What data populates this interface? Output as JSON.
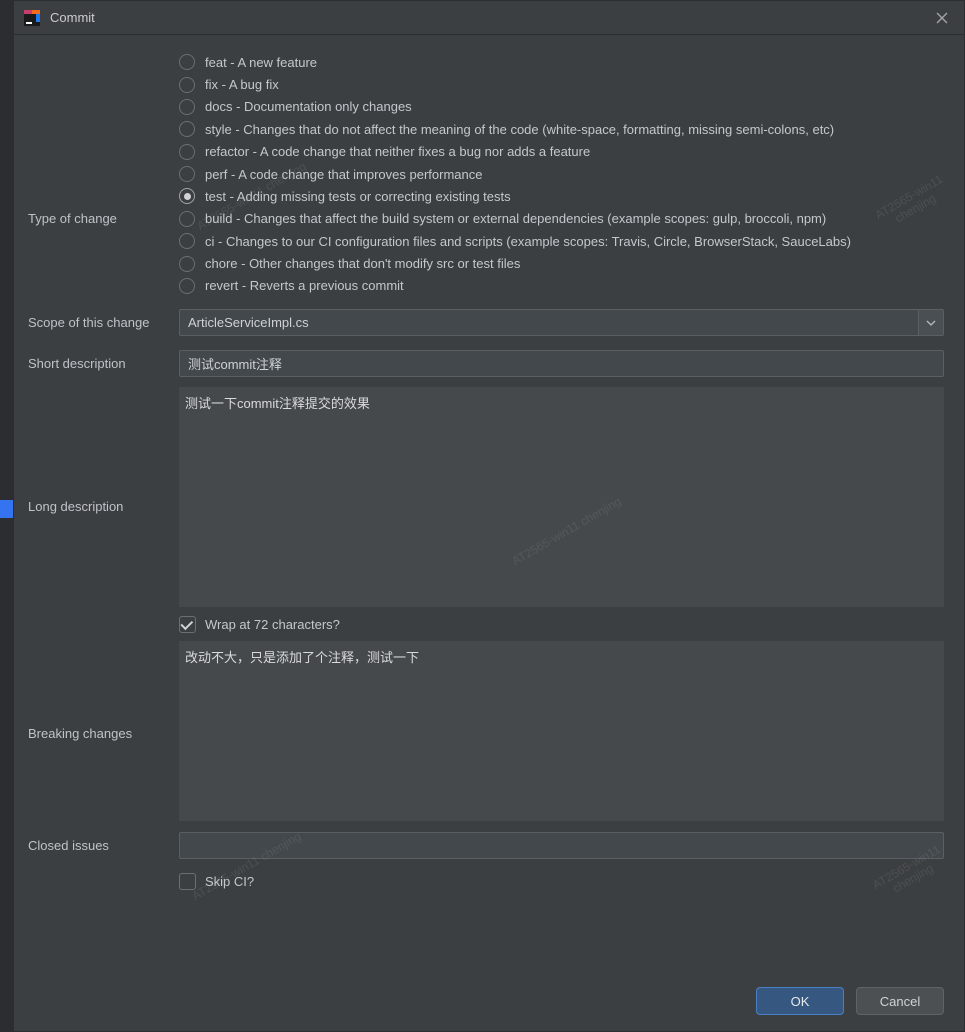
{
  "window": {
    "title": "Commit"
  },
  "labels": {
    "type_of_change": "Type of change",
    "scope": "Scope of this change",
    "short_desc": "Short description",
    "long_desc": "Long description",
    "breaking": "Breaking changes",
    "closed_issues": "Closed issues"
  },
  "change_types": [
    {
      "key": "feat",
      "label": "feat - A new feature",
      "selected": false
    },
    {
      "key": "fix",
      "label": "fix - A bug fix",
      "selected": false
    },
    {
      "key": "docs",
      "label": "docs - Documentation only changes",
      "selected": false
    },
    {
      "key": "style",
      "label": "style - Changes that do not affect the meaning of the code (white-space, formatting, missing semi-colons, etc)",
      "selected": false
    },
    {
      "key": "refactor",
      "label": "refactor - A code change that neither fixes a bug nor adds a feature",
      "selected": false
    },
    {
      "key": "perf",
      "label": "perf - A code change that improves performance",
      "selected": false
    },
    {
      "key": "test",
      "label": "test - Adding missing tests or correcting existing tests",
      "selected": true
    },
    {
      "key": "build",
      "label": "build - Changes that affect the build system or external dependencies (example scopes: gulp, broccoli, npm)",
      "selected": false
    },
    {
      "key": "ci",
      "label": "ci - Changes to our CI configuration files and scripts (example scopes: Travis, Circle, BrowserStack, SauceLabs)",
      "selected": false
    },
    {
      "key": "chore",
      "label": "chore - Other changes that don't modify src or test files",
      "selected": false
    },
    {
      "key": "revert",
      "label": "revert - Reverts a previous commit",
      "selected": false
    }
  ],
  "scope": {
    "value": "ArticleServiceImpl.cs"
  },
  "short_description": {
    "value": "测试commit注释"
  },
  "long_description": {
    "value": "测试一下commit注释提交的效果",
    "wrap_checkbox_label": "Wrap at 72 characters?",
    "wrap_checked": true
  },
  "breaking_changes": {
    "value": "改动不大，只是添加了个注释，测试一下"
  },
  "closed_issues": {
    "value": ""
  },
  "skip_ci": {
    "label": "Skip CI?",
    "checked": false
  },
  "buttons": {
    "ok": "OK",
    "cancel": "Cancel"
  },
  "watermark": "AT2565-win11\nchenjing"
}
